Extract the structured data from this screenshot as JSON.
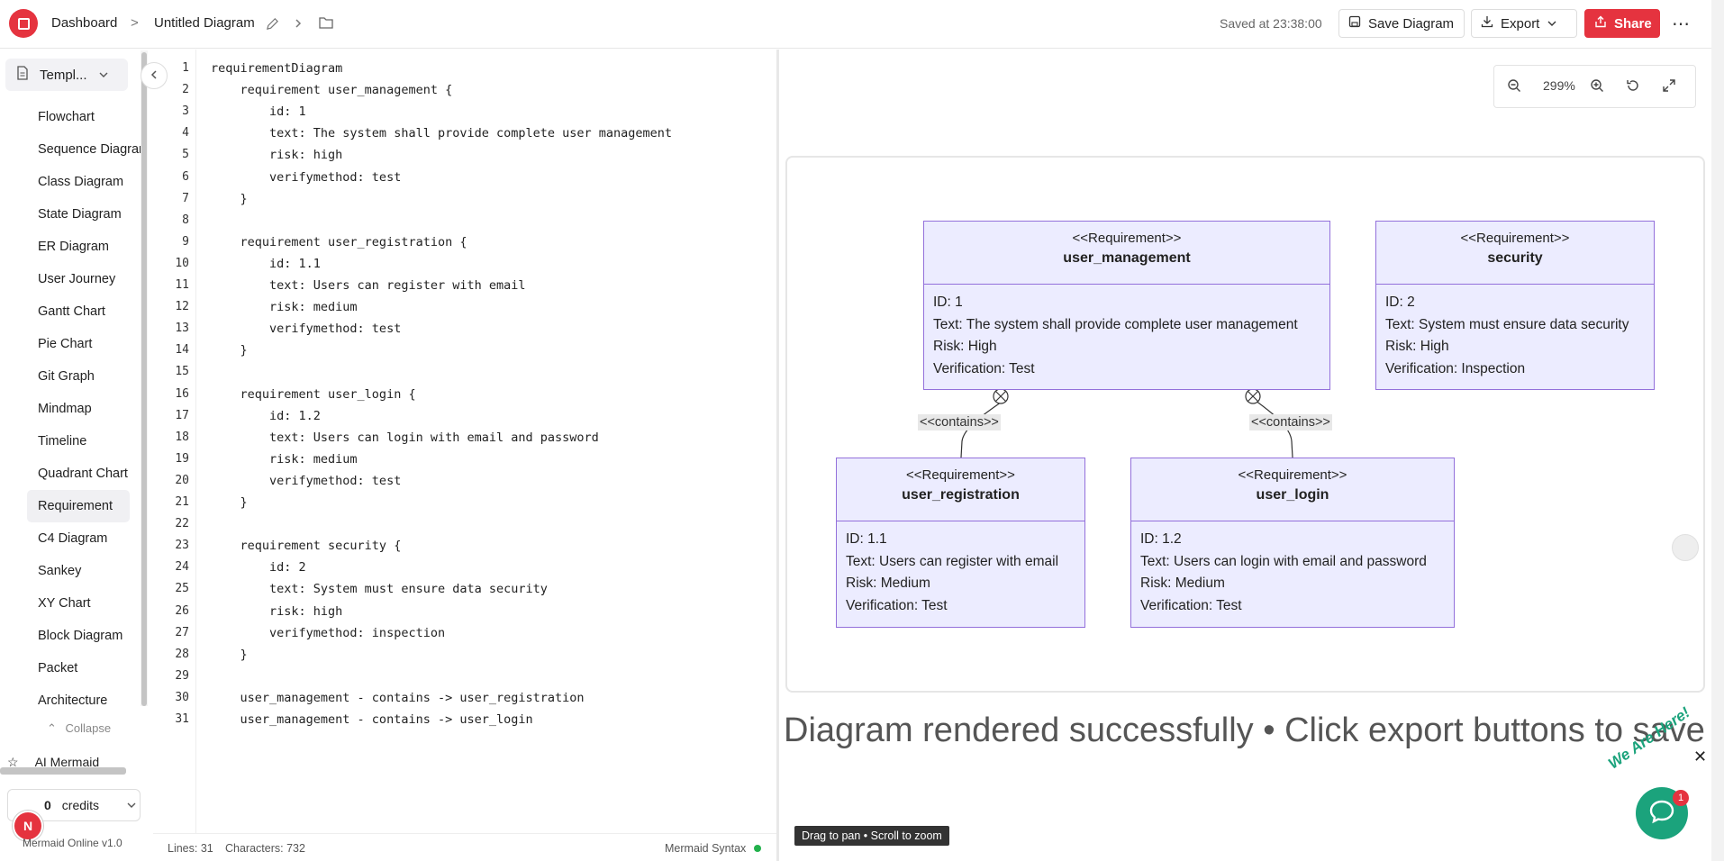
{
  "header": {
    "breadcrumb_dashboard": "Dashboard",
    "breadcrumb_separator": ">",
    "diagram_title": "Untitled Diagram",
    "saved_text": "Saved at 23:38:00",
    "save_label": "Save Diagram",
    "export_label": "Export",
    "share_label": "Share",
    "more_label": "⋯"
  },
  "sidebar": {
    "templates_label": "Templ...",
    "items": [
      {
        "label": "Flowchart"
      },
      {
        "label": "Sequence Diagram"
      },
      {
        "label": "Class Diagram"
      },
      {
        "label": "State Diagram"
      },
      {
        "label": "ER Diagram"
      },
      {
        "label": "User Journey"
      },
      {
        "label": "Gantt Chart"
      },
      {
        "label": "Pie Chart"
      },
      {
        "label": "Git Graph"
      },
      {
        "label": "Mindmap"
      },
      {
        "label": "Timeline"
      },
      {
        "label": "Quadrant Chart"
      },
      {
        "label": "Requirement"
      },
      {
        "label": "C4 Diagram"
      },
      {
        "label": "Sankey"
      },
      {
        "label": "XY Chart"
      },
      {
        "label": "Block Diagram"
      },
      {
        "label": "Packet"
      },
      {
        "label": "Architecture"
      }
    ],
    "active_item": "Requirement",
    "collapse_label": "Collapse",
    "ai_label": "AI Mermaid",
    "credits_count": "0",
    "credits_label": "credits",
    "avatar_initial": "N",
    "version": "Mermaid Online v1.0"
  },
  "editor": {
    "lines": [
      "requirementDiagram",
      "    requirement user_management {",
      "        id: 1",
      "        text: The system shall provide complete user management",
      "        risk: high",
      "        verifymethod: test",
      "    }",
      "",
      "    requirement user_registration {",
      "        id: 1.1",
      "        text: Users can register with email",
      "        risk: medium",
      "        verifymethod: test",
      "    }",
      "",
      "    requirement user_login {",
      "        id: 1.2",
      "        text: Users can login with email and password",
      "        risk: medium",
      "        verifymethod: test",
      "    }",
      "",
      "    requirement security {",
      "        id: 2",
      "        text: System must ensure data security",
      "        risk: high",
      "        verifymethod: inspection",
      "    }",
      "",
      "    user_management - contains -> user_registration",
      "    user_management - contains -> user_login"
    ],
    "status_lines": "Lines: 31",
    "status_chars": "Characters: 732",
    "status_syntax": "Mermaid Syntax"
  },
  "preview": {
    "zoom_level": "299%",
    "requirements": [
      {
        "id": "user_management",
        "stereotype": "<<Requirement>>",
        "name": "user_management",
        "id_line": "ID: 1",
        "text_line": "Text: The system shall provide complete user management",
        "risk_line": "Risk: High",
        "verify_line": "Verification: Test"
      },
      {
        "id": "security",
        "stereotype": "<<Requirement>>",
        "name": "security",
        "id_line": "ID: 2",
        "text_line": "Text: System must ensure data security",
        "risk_line": "Risk: High",
        "verify_line": "Verification: Inspection"
      },
      {
        "id": "user_registration",
        "stereotype": "<<Requirement>>",
        "name": "user_registration",
        "id_line": "ID: 1.1",
        "text_line": "Text: Users can register with email",
        "risk_line": "Risk: Medium",
        "verify_line": "Verification: Test"
      },
      {
        "id": "user_login",
        "stereotype": "<<Requirement>>",
        "name": "user_login",
        "id_line": "ID: 1.2",
        "text_line": "Text: Users can login with email and password",
        "risk_line": "Risk: Medium",
        "verify_line": "Verification: Test"
      }
    ],
    "relations": [
      {
        "label": "<<contains>>"
      },
      {
        "label": "<<contains>>"
      }
    ],
    "status_message": "Diagram rendered successfully • Click export buttons to save",
    "drag_tip": "Drag to pan • Scroll to zoom",
    "chat_badge": "1",
    "chat_banner": "We Are Here!",
    "close_label": "✕"
  },
  "colors": {
    "brand_red": "#e5333f",
    "req_fill": "#ececff",
    "req_border": "#9370db",
    "chat_green": "#1ba37c"
  }
}
